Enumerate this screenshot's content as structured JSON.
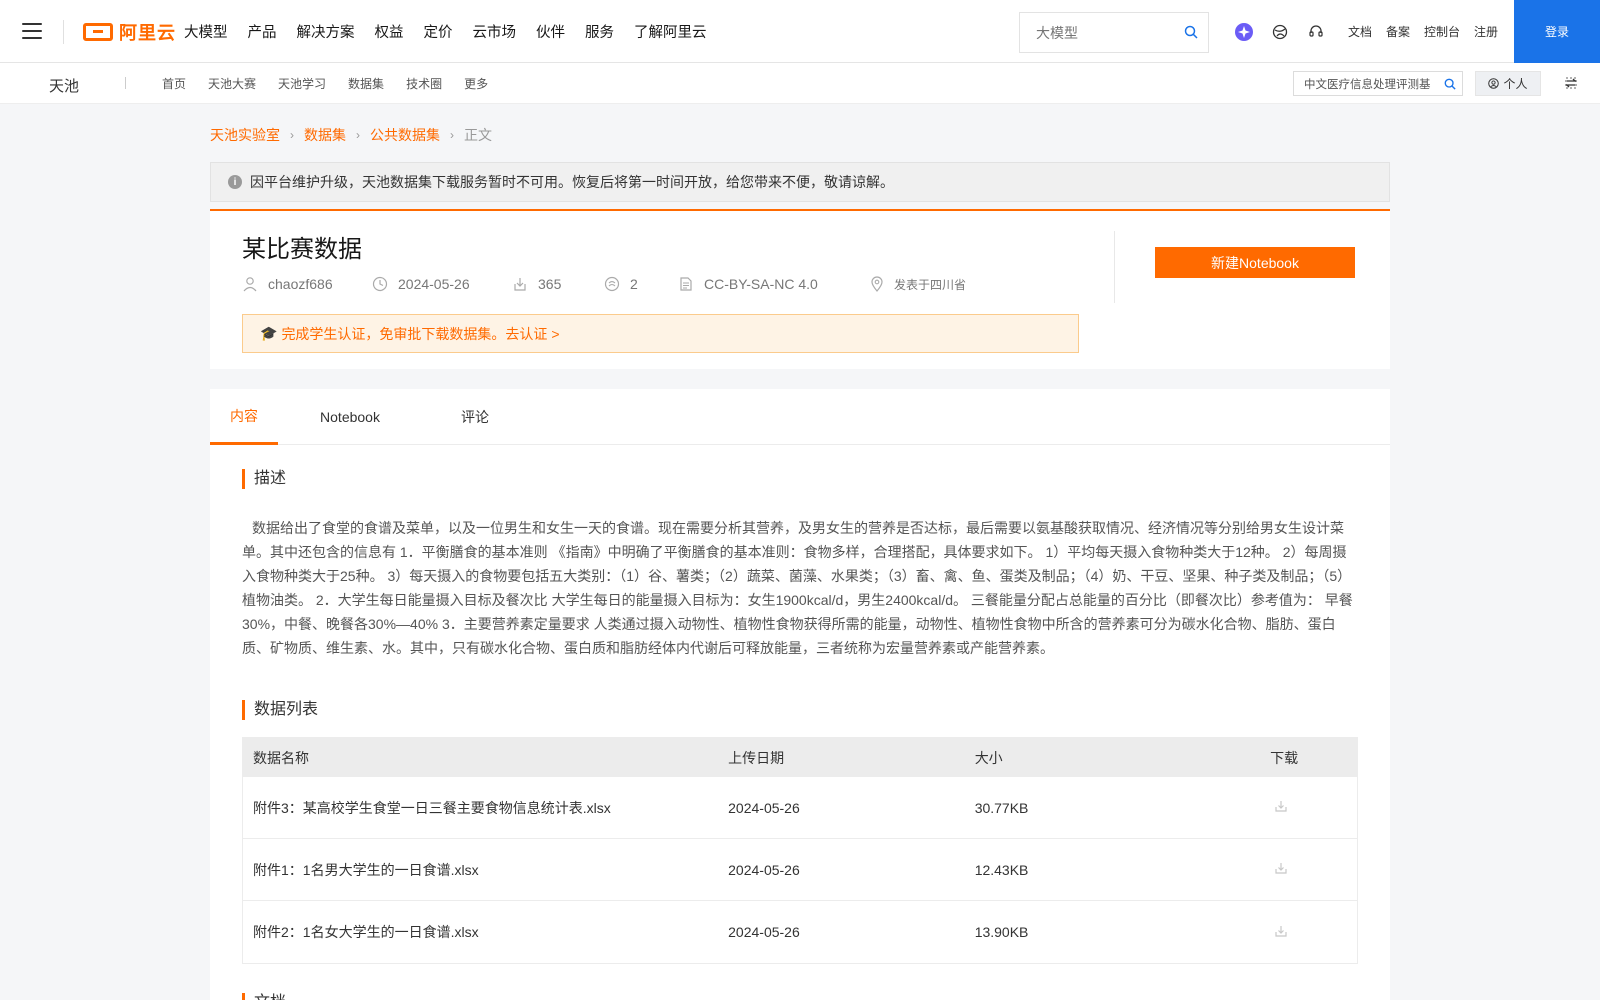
{
  "topbar": {
    "logo_text": "阿里云",
    "nav": [
      "大模型",
      "产品",
      "解决方案",
      "权益",
      "定价",
      "云市场",
      "伙伴",
      "服务",
      "了解阿里云"
    ],
    "search_placeholder": "大模型",
    "links": [
      "文档",
      "备案",
      "控制台",
      "注册"
    ],
    "login_label": "登录"
  },
  "subbar": {
    "title": "天池",
    "nav": [
      "首页",
      "天池大赛",
      "天池学习",
      "数据集",
      "技术圈",
      "更多"
    ],
    "search_value": "中文医疗信息处理评测基",
    "personal_label": "个人"
  },
  "breadcrumb": [
    "天池实验室",
    "数据集",
    "公共数据集",
    "正文"
  ],
  "notice": "因平台维护升级，天池数据集下载服务暂时不可用。恢复后将第一时间开放，给您带来不便，敬请谅解。",
  "dataset": {
    "title": "某比赛数据",
    "author": "chaozf686",
    "date": "2024-05-26",
    "downloads": "365",
    "citations": "2",
    "license": "CC-BY-SA-NC 4.0",
    "location": "发表于四川省",
    "notebook_button": "新建Notebook",
    "student_notice": "完成学生认证，免审批下载数据集。去认证 >"
  },
  "tabs": [
    "内容",
    "Notebook",
    "评论"
  ],
  "description": {
    "title": "描述",
    "text": "数据给出了食堂的食谱及菜单，以及一位男生和女生一天的食谱。现在需要分析其营养，及男女生的营养是否达标，最后需要以氨基酸获取情况、经济情况等分别给男女生设计菜单。其中还包含的信息有 1．平衡膳食的基本准则 《指南》中明确了平衡膳食的基本准则：食物多样，合理搭配，具体要求如下。 1）平均每天摄入食物种类大于12种。 2）每周摄入食物种类大于25种。 3）每天摄入的食物要包括五大类别：（1）谷、薯类；（2）蔬菜、菌藻、水果类；（3）畜、禽、鱼、蛋类及制品；（4）奶、干豆、坚果、种子类及制品；（5）植物油类。 2．大学生每日能量摄入目标及餐次比 大学生每日的能量摄入目标为：女生1900kcal/d，男生2400kcal/d。 三餐能量分配占总能量的百分比（即餐次比）参考值为： 早餐30%，中餐、晚餐各30%—40% 3．主要营养素定量要求 人类通过摄入动物性、植物性食物获得所需的能量，动物性、植物性食物中所含的营养素可分为碳水化合物、脂肪、蛋白质、矿物质、维生素、水。其中，只有碳水化合物、蛋白质和脂肪经体内代谢后可释放能量，三者统称为宏量营养素或产能营养素。"
  },
  "data_list": {
    "title": "数据列表",
    "headers": [
      "数据名称",
      "上传日期",
      "大小",
      "下载"
    ],
    "rows": [
      {
        "name": "附件3：某高校学生食堂一日三餐主要食物信息统计表.xlsx",
        "date": "2024-05-26",
        "size": "30.77KB"
      },
      {
        "name": "附件1：1名男大学生的一日食谱.xlsx",
        "date": "2024-05-26",
        "size": "12.43KB"
      },
      {
        "name": "附件2：1名女大学生的一日食谱.xlsx",
        "date": "2024-05-26",
        "size": "13.90KB"
      }
    ]
  },
  "next_section_title": "文档",
  "colors": {
    "accent": "#ff6a00",
    "login": "#1a73e8"
  }
}
